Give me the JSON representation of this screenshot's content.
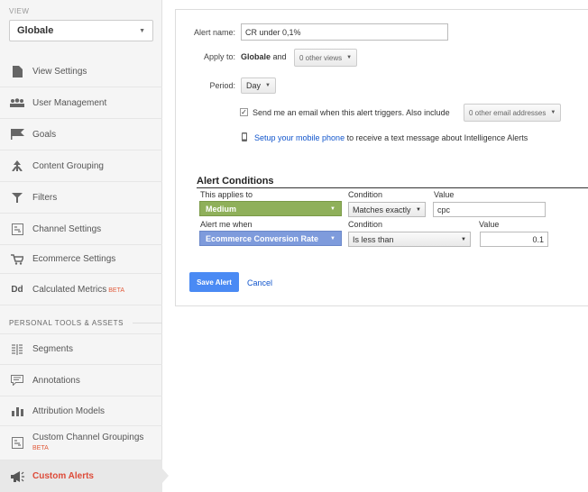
{
  "sidebar": {
    "view_label": "VIEW",
    "view_select": "Globale",
    "items": [
      {
        "label": "View Settings",
        "icon": "document-icon"
      },
      {
        "label": "User Management",
        "icon": "users-icon"
      },
      {
        "label": "Goals",
        "icon": "flag-icon"
      },
      {
        "label": "Content Grouping",
        "icon": "grouping-icon"
      },
      {
        "label": "Filters",
        "icon": "filter-icon"
      },
      {
        "label": "Channel Settings",
        "icon": "channel-icon"
      },
      {
        "label": "Ecommerce Settings",
        "icon": "cart-icon"
      },
      {
        "label": "Calculated Metrics",
        "icon": "dd-icon",
        "icon_text": "Dd",
        "badge": "BETA"
      }
    ],
    "section_header": "PERSONAL TOOLS & ASSETS",
    "personal_items": [
      {
        "label": "Segments",
        "icon": "segments-icon"
      },
      {
        "label": "Annotations",
        "icon": "annotation-icon"
      },
      {
        "label": "Attribution Models",
        "icon": "bar-chart-icon"
      },
      {
        "label": "Custom Channel Groupings",
        "icon": "channel-icon",
        "badge": "BETA"
      },
      {
        "label": "Custom Alerts",
        "icon": "megaphone-icon",
        "active": true
      }
    ]
  },
  "form": {
    "alert_name_label": "Alert name:",
    "alert_name_value": "CR under 0,1%",
    "apply_to_label": "Apply to:",
    "apply_to_view": "Globale",
    "apply_to_and": "and",
    "other_views": "0 other views",
    "period_label": "Period:",
    "period_value": "Day",
    "email_text": "Send me an email when this alert triggers. Also include",
    "email_checked": true,
    "other_emails": "0 other email addresses",
    "mobile_link": "Setup your mobile phone",
    "mobile_text": "to receive a text message about Intelligence Alerts"
  },
  "conditions": {
    "title": "Alert Conditions",
    "applies_label": "This applies to",
    "condition_label": "Condition",
    "value_label": "Value",
    "dimension": "Medium",
    "dimension_condition": "Matches exactly",
    "dimension_value": "cpc",
    "alert_when_label": "Alert me when",
    "metric": "Ecommerce Conversion Rate",
    "metric_condition": "Is less than",
    "metric_value": "0.1"
  },
  "actions": {
    "save": "Save Alert",
    "cancel": "Cancel"
  },
  "colors": {
    "active": "#dd4b39",
    "green_select": "#8fb05a",
    "blue_select": "#7e9bdc",
    "save_button": "#4a8af4",
    "link": "#1155cc"
  }
}
